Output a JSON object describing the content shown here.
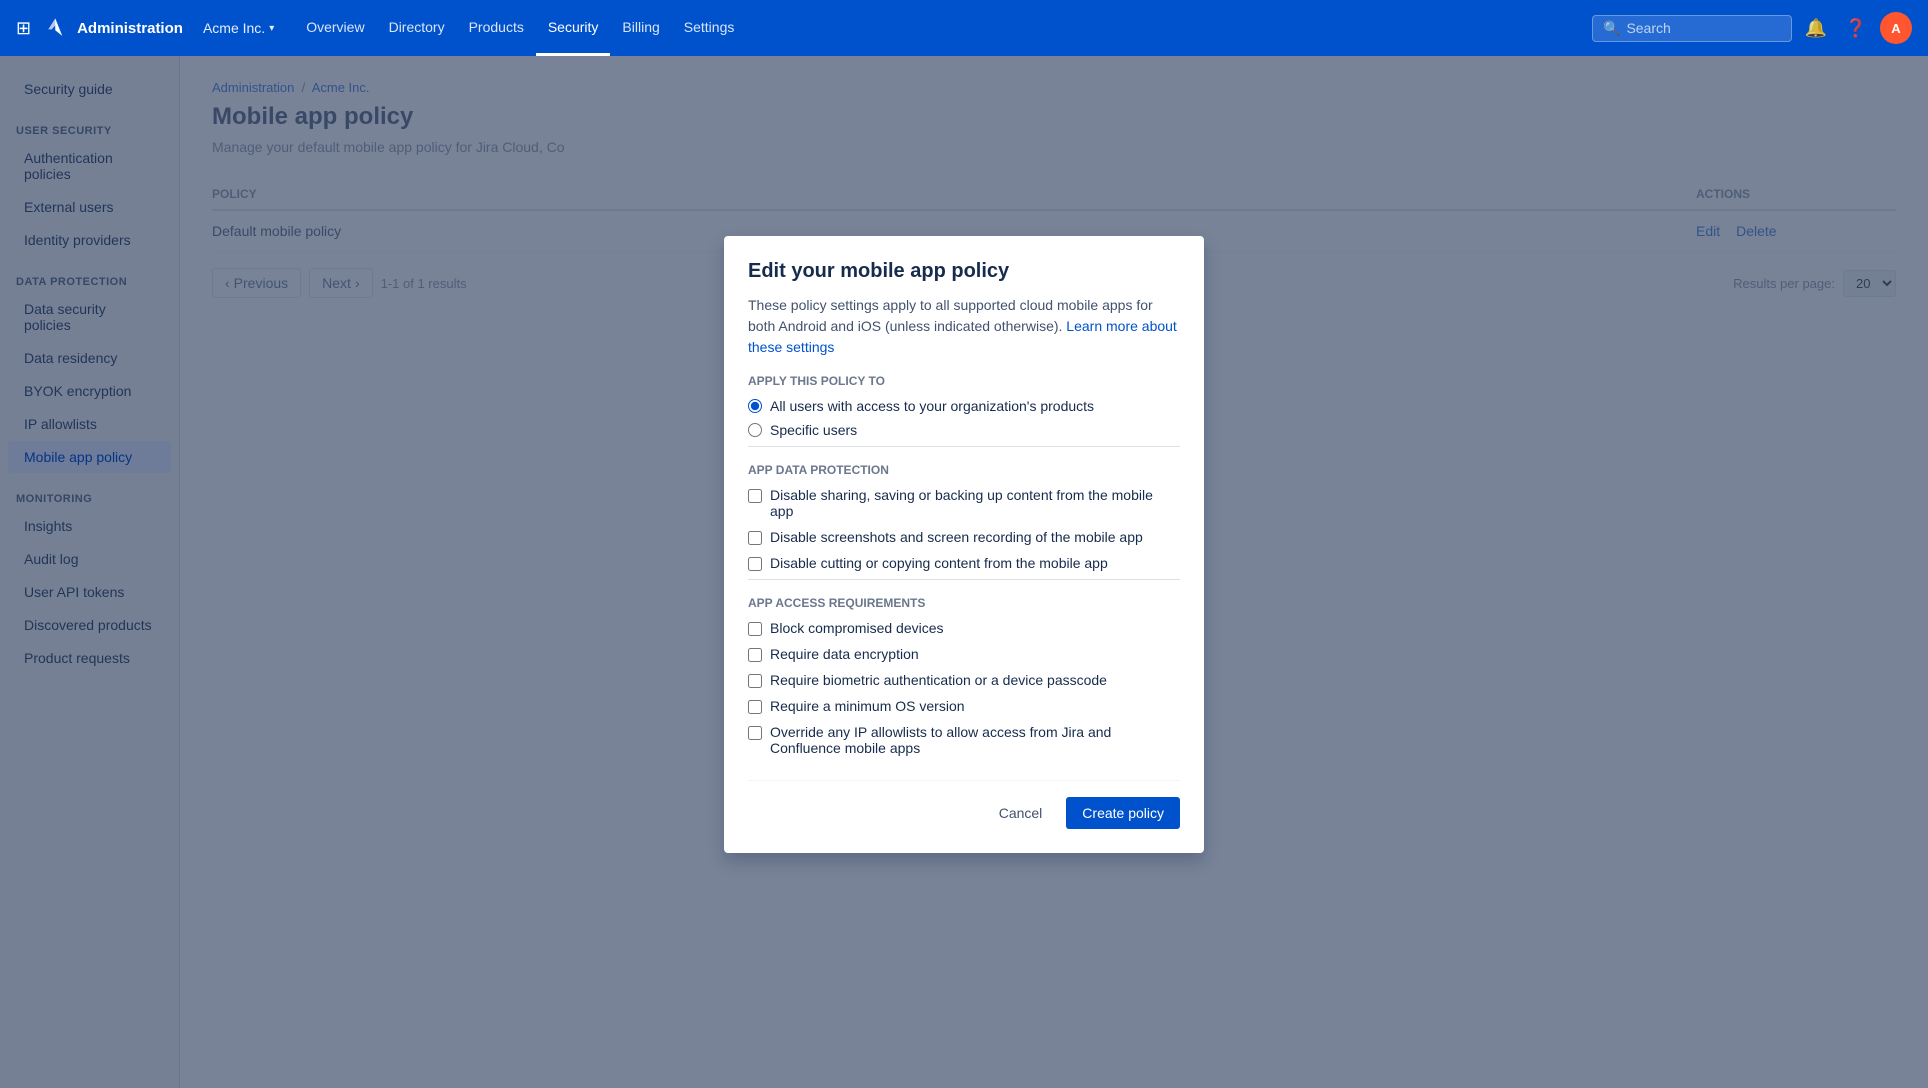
{
  "topNav": {
    "logoText": "Administration",
    "orgName": "Acme Inc.",
    "links": [
      {
        "label": "Overview",
        "active": false
      },
      {
        "label": "Directory",
        "active": false
      },
      {
        "label": "Products",
        "active": false
      },
      {
        "label": "Security",
        "active": true
      },
      {
        "label": "Billing",
        "active": false
      },
      {
        "label": "Settings",
        "active": false
      }
    ],
    "searchPlaceholder": "Search",
    "avatarInitials": "A"
  },
  "sidebar": {
    "topItem": "Security guide",
    "sections": [
      {
        "label": "USER SECURITY",
        "items": [
          {
            "label": "Authentication policies",
            "active": false
          },
          {
            "label": "External users",
            "active": false
          },
          {
            "label": "Identity providers",
            "active": false
          }
        ]
      },
      {
        "label": "DATA PROTECTION",
        "items": [
          {
            "label": "Data security policies",
            "active": false
          },
          {
            "label": "Data residency",
            "active": false
          },
          {
            "label": "BYOK encryption",
            "active": false
          },
          {
            "label": "IP allowlists",
            "active": false
          },
          {
            "label": "Mobile app policy",
            "active": true
          }
        ]
      },
      {
        "label": "MONITORING",
        "items": [
          {
            "label": "Insights",
            "active": false
          },
          {
            "label": "Audit log",
            "active": false
          },
          {
            "label": "User API tokens",
            "active": false
          },
          {
            "label": "Discovered products",
            "active": false
          },
          {
            "label": "Product requests",
            "active": false
          }
        ]
      }
    ]
  },
  "mainContent": {
    "breadcrumb": {
      "admin": "Administration",
      "org": "Acme Inc."
    },
    "pageTitle": "Mobile app policy",
    "pageDesc": "Manage your default mobile app policy for Jira Cloud, Co",
    "tableHeaders": {
      "policy": "Policy",
      "actions": "Actions"
    },
    "tableRow": {
      "policyName": "Default mobile policy",
      "editLabel": "Edit",
      "deleteLabel": "Delete"
    },
    "pagination": {
      "previousLabel": "Previous",
      "nextLabel": "Next",
      "info": "1-1 of 1 results",
      "resultsPerPage": "Results per page:",
      "perPageValue": "20"
    }
  },
  "modal": {
    "title": "Edit your mobile app policy",
    "description": "These policy settings apply to all supported cloud mobile apps for both Android and iOS (unless indicated otherwise).",
    "learnMoreText": "Learn more about these settings",
    "applyLabel": "Apply this policy to",
    "radioOptions": [
      {
        "id": "all-users",
        "label": "All users with access to your organization's products",
        "checked": true
      },
      {
        "id": "specific-users",
        "label": "Specific users",
        "checked": false
      }
    ],
    "appDataProtectionLabel": "App data protection",
    "appDataProtectionOptions": [
      {
        "id": "disable-sharing",
        "label": "Disable sharing, saving or backing up content from the mobile app",
        "checked": false
      },
      {
        "id": "disable-screenshots",
        "label": "Disable screenshots and screen recording of the mobile app",
        "checked": false
      },
      {
        "id": "disable-cutting",
        "label": "Disable cutting or copying content from the mobile app",
        "checked": false
      }
    ],
    "appAccessLabel": "App access requirements",
    "appAccessOptions": [
      {
        "id": "block-compromised",
        "label": "Block compromised devices",
        "checked": false
      },
      {
        "id": "require-encryption",
        "label": "Require data encryption",
        "checked": false
      },
      {
        "id": "require-biometric",
        "label": "Require biometric authentication or a device passcode",
        "checked": false
      },
      {
        "id": "require-os",
        "label": "Require a minimum OS version",
        "checked": false
      },
      {
        "id": "override-ip",
        "label": "Override any IP allowlists to allow access from Jira and Confluence mobile apps",
        "checked": false
      }
    ],
    "cancelLabel": "Cancel",
    "createLabel": "Create policy"
  }
}
